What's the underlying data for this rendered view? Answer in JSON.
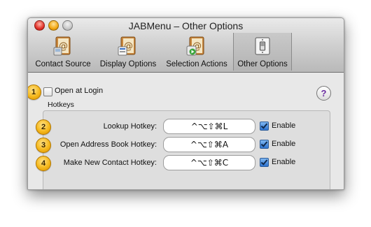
{
  "window": {
    "title": "JABMenu – Other Options"
  },
  "toolbar": {
    "items": [
      {
        "label": "Contact Source",
        "icon": "address-book-source-icon"
      },
      {
        "label": "Display Options",
        "icon": "address-book-display-icon"
      },
      {
        "label": "Selection Actions",
        "icon": "address-book-actions-icon"
      },
      {
        "label": "Other Options",
        "icon": "light-switch-icon"
      }
    ],
    "selected": "Other Options"
  },
  "content": {
    "open_at_login": {
      "label": "Open at Login",
      "checked": false
    },
    "hotkeys_title": "Hotkeys",
    "hotkeys": [
      {
        "badge": "2",
        "label": "Lookup Hotkey:",
        "value": "^⌥⇧⌘L",
        "enable_label": "Enable",
        "enabled": true
      },
      {
        "badge": "3",
        "label": "Open Address Book Hotkey:",
        "value": "^⌥⇧⌘A",
        "enable_label": "Enable",
        "enabled": true
      },
      {
        "badge": "4",
        "label": "Make New Contact Hotkey:",
        "value": "^⌥⇧⌘C",
        "enable_label": "Enable",
        "enabled": true
      }
    ],
    "badge_1": "1",
    "help_symbol": "?"
  },
  "colors": {
    "badge": "#f5b81c",
    "checkbox_checked": "#2d73cf",
    "help": "#6a2da0"
  }
}
